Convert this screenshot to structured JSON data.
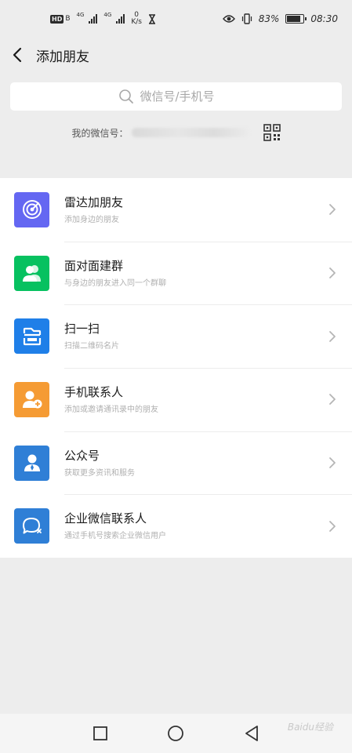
{
  "status_bar": {
    "network_badge": "HD",
    "network_badge_sub": "B",
    "sim1_network": "4G",
    "sim2_network": "4G",
    "speed_value": "0",
    "speed_unit": "K/s",
    "battery_percent_text": "83%",
    "battery_level": 0.83,
    "time": "08:30"
  },
  "header": {
    "title": "添加朋友"
  },
  "search": {
    "placeholder": "微信号/手机号"
  },
  "my_id": {
    "label": "我的微信号："
  },
  "menu": [
    {
      "title": "雷达加朋友",
      "subtitle": "添加身边的朋友",
      "icon": "radar-icon",
      "color": "#6467f2"
    },
    {
      "title": "面对面建群",
      "subtitle": "与身边的朋友进入同一个群聊",
      "icon": "group-icon",
      "color": "#07c160"
    },
    {
      "title": "扫一扫",
      "subtitle": "扫描二维码名片",
      "icon": "scan-icon",
      "color": "#1f7fe8"
    },
    {
      "title": "手机联系人",
      "subtitle": "添加或邀请通讯录中的朋友",
      "icon": "add-contact-icon",
      "color": "#f59b34"
    },
    {
      "title": "公众号",
      "subtitle": "获取更多资讯和服务",
      "icon": "official-account-icon",
      "color": "#2f7fd6"
    },
    {
      "title": "企业微信联系人",
      "subtitle": "通过手机号搜索企业微信用户",
      "icon": "work-chat-icon",
      "color": "#2f7fd6"
    }
  ],
  "watermark": "Baidu经验"
}
